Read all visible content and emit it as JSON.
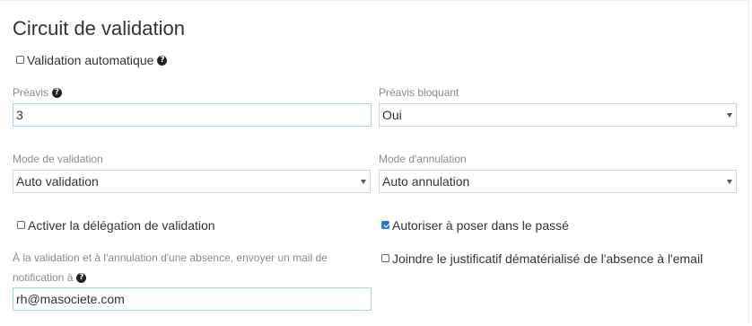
{
  "section": {
    "title": "Circuit de validation"
  },
  "validation_auto": {
    "label": "Validation automatique",
    "checked": false,
    "help_icon": "question-circle-icon"
  },
  "preavis": {
    "label": "Préavis",
    "value": "3",
    "help_icon": "question-circle-icon"
  },
  "preavis_bloquant": {
    "label": "Préavis bloquant",
    "value": "Oui"
  },
  "mode_validation": {
    "label": "Mode de validation",
    "value": "Auto validation"
  },
  "mode_annulation": {
    "label": "Mode d'annulation",
    "value": "Auto annulation"
  },
  "delegation": {
    "label": "Activer la délégation de validation",
    "checked": false
  },
  "poser_passe": {
    "label": "Autoriser à poser dans le passé",
    "checked": true
  },
  "mail_notification": {
    "label_line1": "À la validation et à l'annulation d'une absence, envoyer un mail de",
    "label_line2": "notification à",
    "value": "rh@masociete.com",
    "help_icon": "question-circle-icon"
  },
  "justificatif": {
    "label": "Joindre le justificatif dématérialisé de l'absence à l'email",
    "checked": false
  },
  "colors": {
    "accent": "#1b7bd8",
    "input_border": "#a9d2ee",
    "label_gray": "#8a8a8a"
  }
}
